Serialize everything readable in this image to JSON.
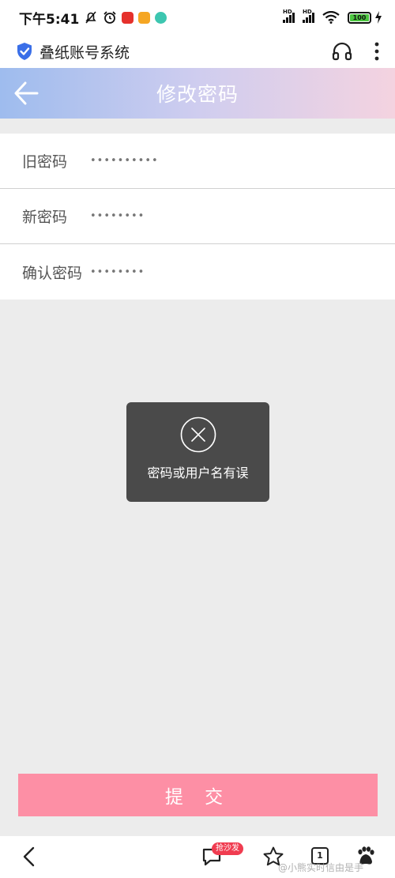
{
  "status_bar": {
    "time": "下午5:41",
    "battery": "100",
    "icons": [
      "bell-off-icon",
      "alarm-icon",
      "netease-music-icon",
      "notes-app-icon",
      "chat-app-icon",
      "hd-signal-icon",
      "hd-signal-icon",
      "wifi-icon",
      "battery-icon",
      "charging-icon"
    ]
  },
  "browser": {
    "site_title": "叠纸账号系统",
    "icons": [
      "shield-check-icon",
      "headphones-icon",
      "more-vertical-icon"
    ]
  },
  "header": {
    "title": "修改密码"
  },
  "form": {
    "fields": [
      {
        "label": "旧密码",
        "value": "••••••••••"
      },
      {
        "label": "新密码",
        "value": "••••••••"
      },
      {
        "label": "确认密码",
        "value": "••••••••"
      }
    ]
  },
  "toast": {
    "message": "密码或用户名有误"
  },
  "submit_label": "提 交",
  "bottom_nav": {
    "comment_badge": "抢沙发",
    "tab_count": "1"
  },
  "watermark": "@小熊实时信由是手",
  "colors": {
    "header_gradient_start": "#9ebcee",
    "header_gradient_end": "#f4d3e0",
    "submit_button": "#fd8fa5",
    "toast_bg": "#4a4a4a",
    "page_bg": "#ececec",
    "badge": "#f03c50"
  }
}
